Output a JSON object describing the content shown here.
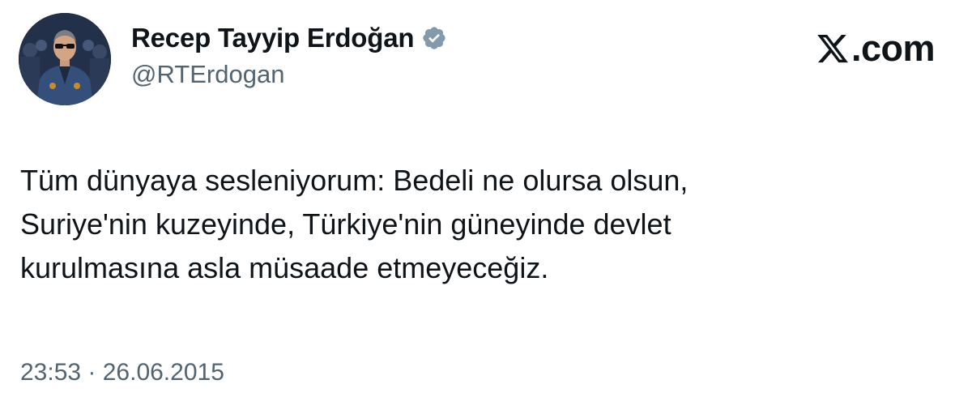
{
  "author": {
    "display_name": "Recep Tayyip Erdoğan",
    "handle": "@RTErdogan",
    "verified_badge": "verified-badge-icon",
    "badge_color": "#829aab"
  },
  "brand": {
    "label": ".com",
    "icon": "x-logo-icon"
  },
  "tweet": {
    "lines": [
      "Tüm dünyaya sesleniyorum: Bedeli ne olursa olsun,",
      "Suriye'nin kuzeyinde, Türkiye'nin güneyinde devlet",
      "kurulmasına asla müsaade etmeyeceğiz."
    ],
    "timestamp": "23:53 · 26.06.2015"
  },
  "colors": {
    "text_primary": "#0f1419",
    "text_secondary": "#536471",
    "background": "#ffffff"
  }
}
